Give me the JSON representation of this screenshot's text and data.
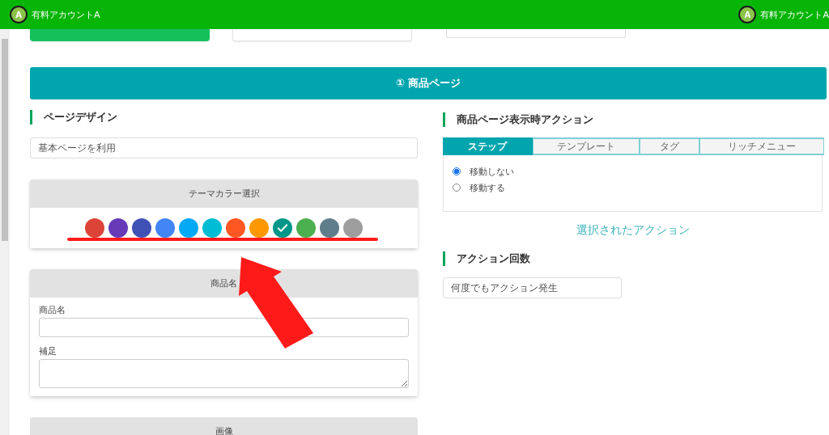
{
  "header": {
    "account_left": {
      "avatar": "A",
      "name": "有料アカウントA"
    },
    "account_right": {
      "avatar": "A",
      "name": "有料アカウントA"
    }
  },
  "top_buttons": [
    {
      "selected": true
    },
    {
      "selected": false
    }
  ],
  "banner": {
    "title": "① 商品ページ"
  },
  "page_design": {
    "heading": "ページデザイン",
    "select_value": "基本ページを利用",
    "theme_card": {
      "title": "テーマカラー選択",
      "colors": [
        {
          "color": "#db4437",
          "selected": false
        },
        {
          "color": "#673ab7",
          "selected": false
        },
        {
          "color": "#3f51b5",
          "selected": false
        },
        {
          "color": "#4285f4",
          "selected": false
        },
        {
          "color": "#03a9f4",
          "selected": false
        },
        {
          "color": "#00bcd4",
          "selected": false
        },
        {
          "color": "#ff5722",
          "selected": false
        },
        {
          "color": "#ff9800",
          "selected": false
        },
        {
          "color": "#009688",
          "selected": true
        },
        {
          "color": "#4caf50",
          "selected": false
        },
        {
          "color": "#607d8b",
          "selected": false
        },
        {
          "color": "#9e9e9e",
          "selected": false
        }
      ]
    },
    "product_card": {
      "title": "商品名",
      "fields": [
        {
          "kind": "input",
          "label": "商品名"
        },
        {
          "kind": "textarea",
          "label": "補足"
        }
      ]
    },
    "image_card": {
      "title": "画像"
    }
  },
  "action": {
    "heading": "商品ページ表示時アクション",
    "tabs": [
      {
        "label": "ステップ",
        "selected": true
      },
      {
        "label": "テンプレート",
        "selected": false
      },
      {
        "label": "タグ",
        "selected": false
      },
      {
        "label": "リッチメニュー",
        "selected": false
      }
    ],
    "options": [
      {
        "label": "移動しない",
        "selected": true
      },
      {
        "label": "移動する",
        "selected": false
      }
    ],
    "selected_action": "選択されたアクション"
  },
  "action_count": {
    "heading": "アクション回数",
    "select_value": "何度でもアクション発生"
  }
}
